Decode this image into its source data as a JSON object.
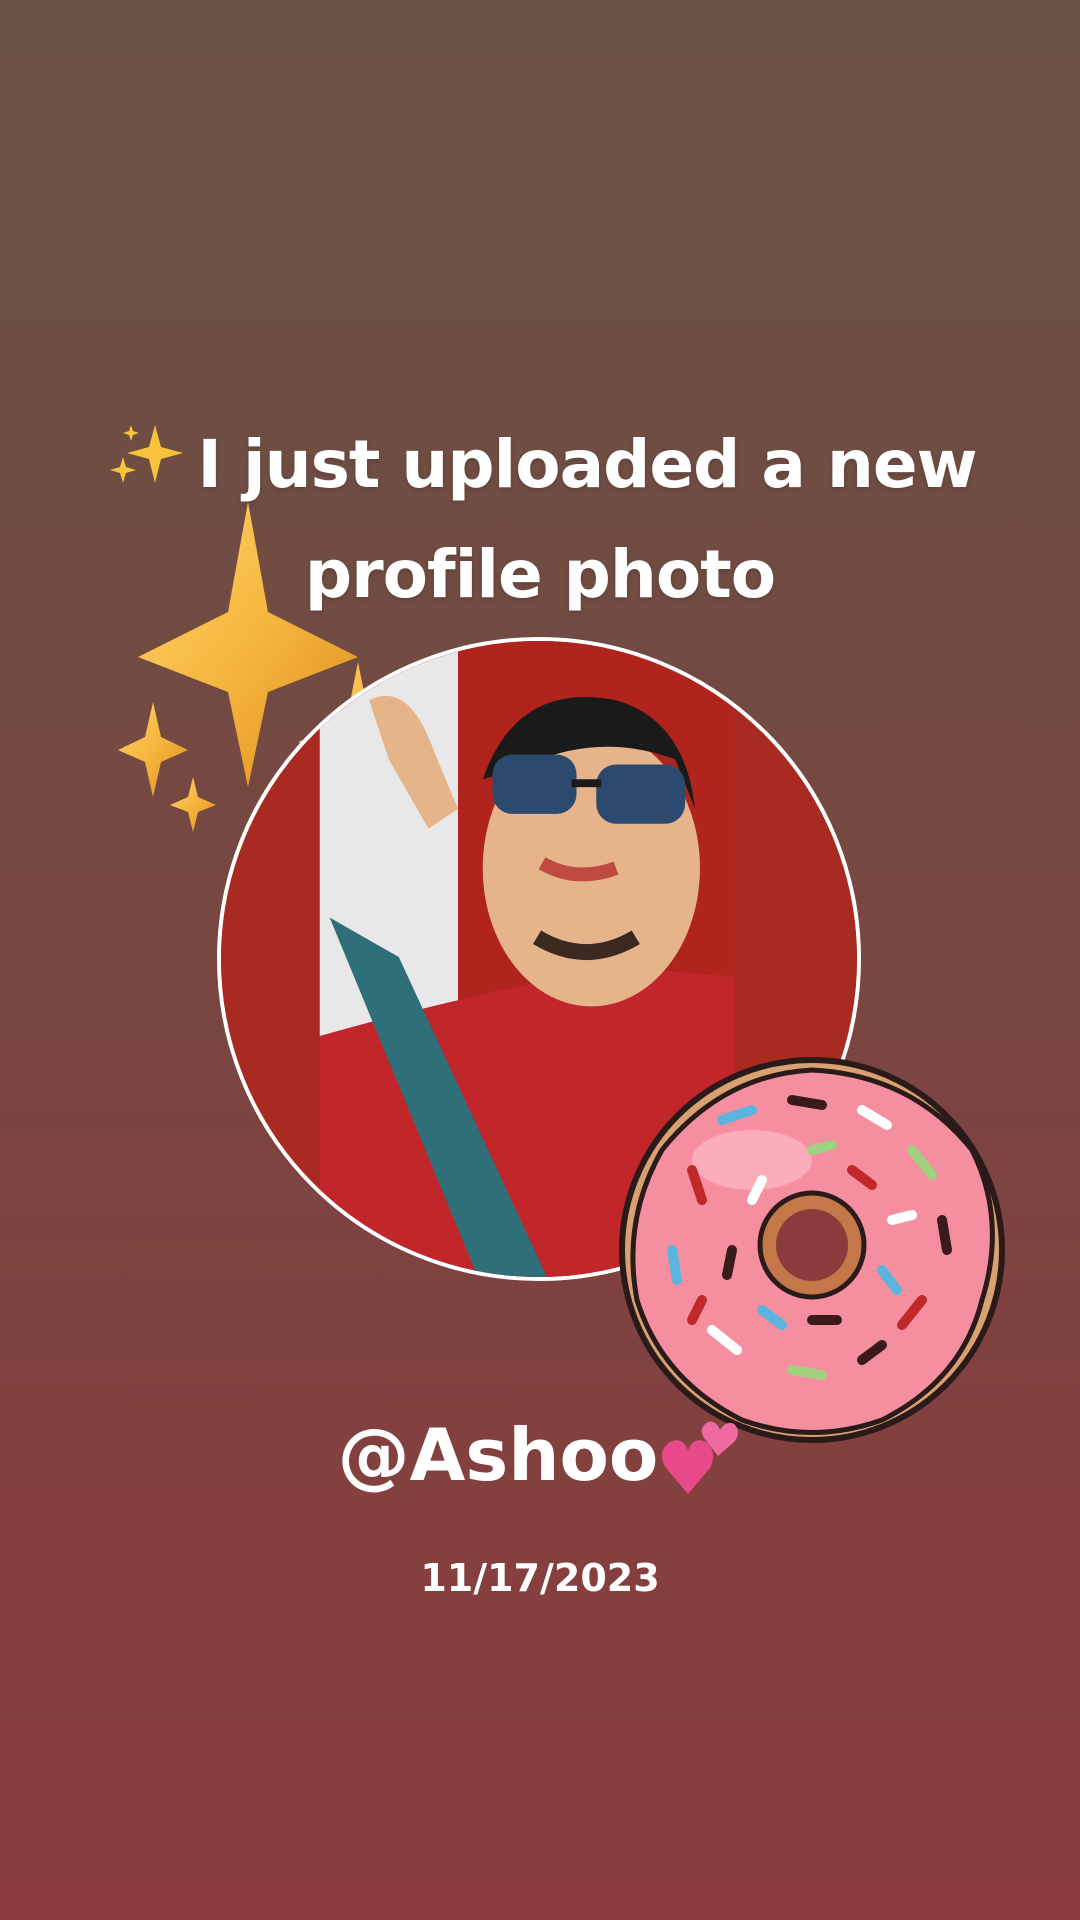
{
  "post": {
    "headline_emoji": "✨",
    "headline_text": "I just uploaded a new profile photo",
    "handle": "@Ashoo",
    "handle_emoji": "💕",
    "date": "11/17/2023"
  },
  "decorations": {
    "sparkles": "sparkles-icon",
    "donut": "donut-sticker",
    "heart": "two-hearts-icon"
  },
  "colors": {
    "background_top": "#6a5244",
    "background_bottom": "#8a3b3c",
    "avatar_border": "#ffffff",
    "avatar_fill": "#a82a20",
    "sparkle_gold": "#f5b63e",
    "donut_icing": "#f58f9f",
    "text": "#ffffff"
  }
}
